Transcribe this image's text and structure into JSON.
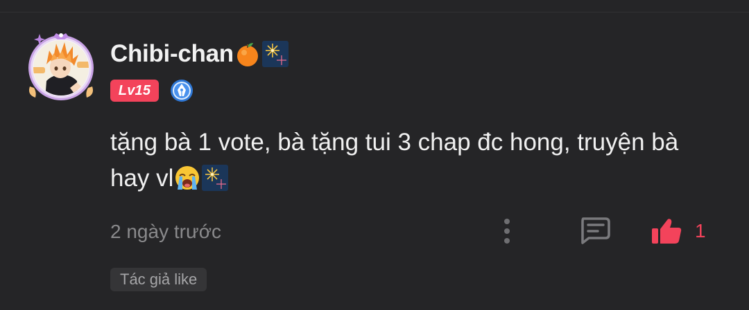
{
  "comment": {
    "username": "Chibi-chan",
    "username_emojis": [
      "tangerine-emoji",
      "fireworks-emoji"
    ],
    "level": "Lv15",
    "level_color": "#f3435b",
    "badge_icon": "pen-nib-icon",
    "text_line1": "tặng bà 1 vote, bà tặng tui 3 chap đc hong, truyện bà",
    "text_line2": "hay vl",
    "text_emojis": [
      "loudly-crying-emoji",
      "fireworks-emoji"
    ],
    "time": "2 ngày trước",
    "like_count": "1",
    "author_like_label": "Tác giả like"
  },
  "icons": {
    "more": "vertical-dots-icon",
    "reply": "chat-bubble-icon",
    "like": "thumbs-up-icon"
  },
  "colors": {
    "background": "#252527",
    "accent": "#f3435b",
    "text": "#f0f0f0",
    "muted": "#8a8a8c"
  }
}
